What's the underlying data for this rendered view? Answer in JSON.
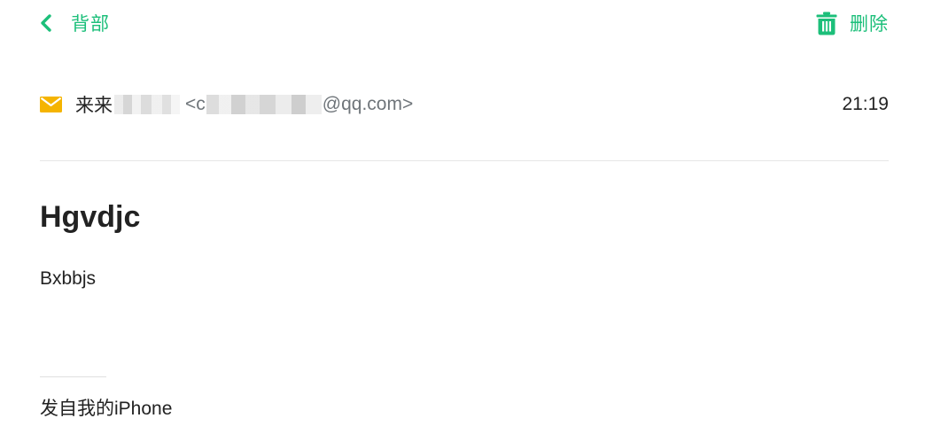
{
  "toolbar": {
    "back_icon": "chevron-left-icon",
    "back_label": "背部",
    "delete_icon": "trash-icon",
    "delete_label": "删除",
    "accent_color": "#1cbf7a"
  },
  "message": {
    "mail_icon": "envelope-icon",
    "mail_icon_color": "#f5b400",
    "sender_name_visible": "来来",
    "sender_address_start": "<c",
    "sender_address_end": "@qq.com>",
    "time": "21:19",
    "subject": "Hgvdjc",
    "body": "Bxbbjs",
    "signature": "发自我的iPhone"
  }
}
